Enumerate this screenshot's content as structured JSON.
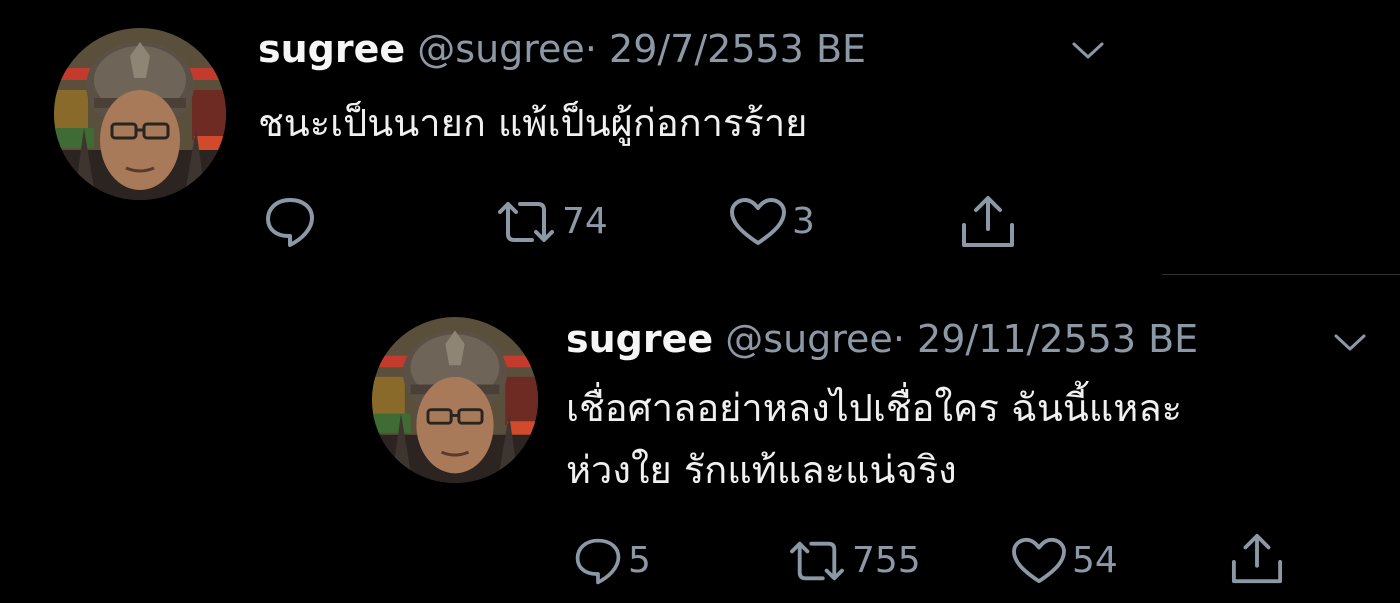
{
  "tweets": [
    {
      "name": "sugree",
      "handle": "@sugree",
      "separator": "·",
      "date": "29/7/2553 BE",
      "text_lines": [
        "ชนะเป็นนายก แพ้เป็นผู้ก่อการร้าย"
      ],
      "actions": {
        "reply_count": "",
        "retweet_count": "74",
        "like_count": "3"
      }
    },
    {
      "name": "sugree",
      "handle": "@sugree",
      "separator": "·",
      "date": "29/11/2553 BE",
      "text_lines": [
        "เชื่อศาลอย่าหลงไปเชื่อใคร ฉันนี้แหละ",
        "ห่วงใย รักแท้และแน่จริง"
      ],
      "actions": {
        "reply_count": "5",
        "retweet_count": "755",
        "like_count": "54"
      }
    }
  ],
  "icons": {
    "reply": "reply-icon",
    "retweet": "retweet-icon",
    "like": "heart-icon",
    "share": "share-icon",
    "menu": "chevron-down-icon"
  },
  "colors": {
    "background": "#000000",
    "text": "#e7e9ea",
    "muted": "#8b98a5",
    "divider": "#2f3336"
  }
}
